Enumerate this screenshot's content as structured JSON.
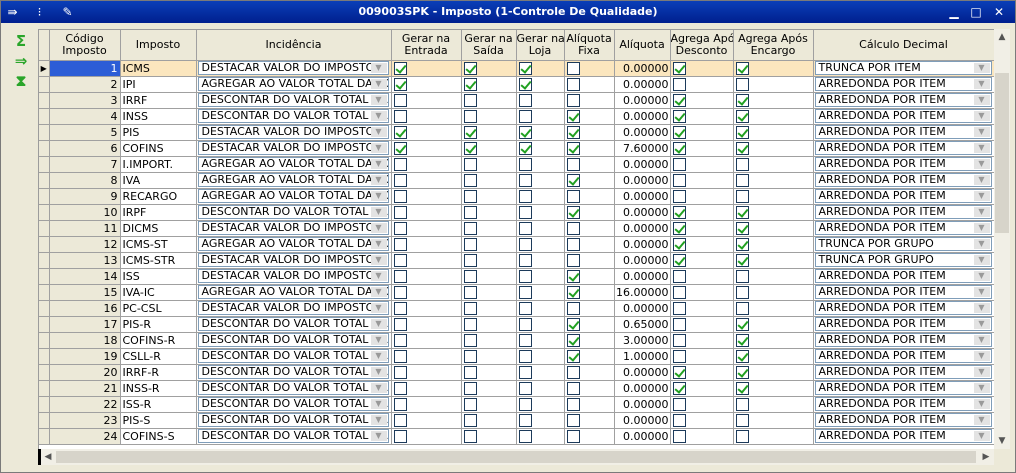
{
  "window": {
    "title": "009003SPK - Imposto (1-Controle De Qualidade)",
    "icons": [
      "menu-arrow-icon",
      "traffic-light-icon",
      "wrench-icon"
    ],
    "controls": {
      "minimize": "▁",
      "maximize": "□",
      "close": "✕"
    }
  },
  "sidebar": [
    {
      "name": "sum-icon",
      "glyph": "Σ"
    },
    {
      "name": "export-icon",
      "glyph": "⇒"
    },
    {
      "name": "filter-icon",
      "glyph": "⧗"
    }
  ],
  "columns": [
    {
      "key": "codigo",
      "label_lines": [
        "Código",
        "Imposto"
      ]
    },
    {
      "key": "imposto",
      "label_lines": [
        "Imposto"
      ]
    },
    {
      "key": "incidencia",
      "label_lines": [
        "Incidência"
      ]
    },
    {
      "key": "gerar_entrada",
      "label_lines": [
        "Gerar na",
        "Entrada"
      ]
    },
    {
      "key": "gerar_saida",
      "label_lines": [
        "Gerar na",
        "Saída"
      ]
    },
    {
      "key": "gerar_loja",
      "label_lines": [
        "Gerar na",
        "Loja"
      ]
    },
    {
      "key": "aliquota_fixa",
      "label_lines": [
        "Alíquota",
        "Fixa"
      ]
    },
    {
      "key": "aliquota",
      "label_lines": [
        "Alíquota"
      ]
    },
    {
      "key": "agrega_desconto",
      "label_lines": [
        "Agrega Após",
        "Desconto"
      ]
    },
    {
      "key": "agrega_encargo",
      "label_lines": [
        "Agrega Após",
        "Encargo"
      ]
    },
    {
      "key": "calculo",
      "label_lines": [
        "Cálculo Decimal"
      ]
    }
  ],
  "rows": [
    {
      "codigo": "1",
      "imposto": "ICMS",
      "incidencia": "DESTACAR VALOR DO IMPOSTO",
      "gerar_entrada": true,
      "gerar_saida": true,
      "gerar_loja": true,
      "aliquota_fixa": false,
      "aliquota": "0.00000",
      "agrega_desconto": true,
      "agrega_encargo": true,
      "calculo": "TRUNCA POR ITEM",
      "selected": true
    },
    {
      "codigo": "2",
      "imposto": "IPI",
      "incidencia": "AGREGAR AO VALOR TOTAL DA NO",
      "gerar_entrada": true,
      "gerar_saida": true,
      "gerar_loja": true,
      "aliquota_fixa": false,
      "aliquota": "0.00000",
      "agrega_desconto": false,
      "agrega_encargo": false,
      "calculo": "ARREDONDA POR ITEM"
    },
    {
      "codigo": "3",
      "imposto": "IRRF",
      "incidencia": "DESCONTAR DO VALOR TOTAL DA",
      "gerar_entrada": false,
      "gerar_saida": false,
      "gerar_loja": false,
      "aliquota_fixa": false,
      "aliquota": "0.00000",
      "agrega_desconto": true,
      "agrega_encargo": true,
      "calculo": "ARREDONDA POR ITEM"
    },
    {
      "codigo": "4",
      "imposto": "INSS",
      "incidencia": "DESCONTAR DO VALOR TOTAL DA",
      "gerar_entrada": false,
      "gerar_saida": false,
      "gerar_loja": false,
      "aliquota_fixa": true,
      "aliquota": "0.00000",
      "agrega_desconto": true,
      "agrega_encargo": true,
      "calculo": "ARREDONDA POR ITEM"
    },
    {
      "codigo": "5",
      "imposto": "PIS",
      "incidencia": "DESTACAR VALOR DO IMPOSTO",
      "gerar_entrada": true,
      "gerar_saida": true,
      "gerar_loja": true,
      "aliquota_fixa": true,
      "aliquota": "0.00000",
      "agrega_desconto": true,
      "agrega_encargo": true,
      "calculo": "ARREDONDA POR ITEM"
    },
    {
      "codigo": "6",
      "imposto": "COFINS",
      "incidencia": "DESTACAR VALOR DO IMPOSTO",
      "gerar_entrada": true,
      "gerar_saida": true,
      "gerar_loja": true,
      "aliquota_fixa": true,
      "aliquota": "7.60000",
      "agrega_desconto": true,
      "agrega_encargo": true,
      "calculo": "ARREDONDA POR ITEM"
    },
    {
      "codigo": "7",
      "imposto": "I.IMPORT.",
      "incidencia": "AGREGAR AO VALOR TOTAL DA NO",
      "gerar_entrada": false,
      "gerar_saida": false,
      "gerar_loja": false,
      "aliquota_fixa": false,
      "aliquota": "0.00000",
      "agrega_desconto": false,
      "agrega_encargo": false,
      "calculo": "ARREDONDA POR ITEM"
    },
    {
      "codigo": "8",
      "imposto": "IVA",
      "incidencia": "AGREGAR AO VALOR TOTAL DA NO",
      "gerar_entrada": false,
      "gerar_saida": false,
      "gerar_loja": false,
      "aliquota_fixa": true,
      "aliquota": "0.00000",
      "agrega_desconto": false,
      "agrega_encargo": false,
      "calculo": "ARREDONDA POR ITEM"
    },
    {
      "codigo": "9",
      "imposto": "RECARGO",
      "incidencia": "AGREGAR AO VALOR TOTAL DA NO",
      "gerar_entrada": false,
      "gerar_saida": false,
      "gerar_loja": false,
      "aliquota_fixa": false,
      "aliquota": "0.00000",
      "agrega_desconto": false,
      "agrega_encargo": false,
      "calculo": "ARREDONDA POR ITEM"
    },
    {
      "codigo": "10",
      "imposto": "IRPF",
      "incidencia": "DESCONTAR DO VALOR TOTAL DA",
      "gerar_entrada": false,
      "gerar_saida": false,
      "gerar_loja": false,
      "aliquota_fixa": true,
      "aliquota": "0.00000",
      "agrega_desconto": true,
      "agrega_encargo": true,
      "calculo": "ARREDONDA POR ITEM"
    },
    {
      "codigo": "11",
      "imposto": "DICMS",
      "incidencia": "DESTACAR VALOR DO IMPOSTO",
      "gerar_entrada": false,
      "gerar_saida": false,
      "gerar_loja": false,
      "aliquota_fixa": false,
      "aliquota": "0.00000",
      "agrega_desconto": true,
      "agrega_encargo": true,
      "calculo": "ARREDONDA POR ITEM"
    },
    {
      "codigo": "12",
      "imposto": "ICMS-ST",
      "incidencia": "AGREGAR AO VALOR TOTAL DA NO",
      "gerar_entrada": false,
      "gerar_saida": false,
      "gerar_loja": false,
      "aliquota_fixa": false,
      "aliquota": "0.00000",
      "agrega_desconto": true,
      "agrega_encargo": true,
      "calculo": "TRUNCA POR GRUPO"
    },
    {
      "codigo": "13",
      "imposto": "ICMS-STR",
      "incidencia": "DESTACAR VALOR DO IMPOSTO",
      "gerar_entrada": false,
      "gerar_saida": false,
      "gerar_loja": false,
      "aliquota_fixa": false,
      "aliquota": "0.00000",
      "agrega_desconto": true,
      "agrega_encargo": true,
      "calculo": "TRUNCA POR GRUPO"
    },
    {
      "codigo": "14",
      "imposto": "ISS",
      "incidencia": "DESTACAR VALOR DO IMPOSTO",
      "gerar_entrada": false,
      "gerar_saida": false,
      "gerar_loja": false,
      "aliquota_fixa": true,
      "aliquota": "0.00000",
      "agrega_desconto": false,
      "agrega_encargo": false,
      "calculo": "ARREDONDA POR ITEM"
    },
    {
      "codigo": "15",
      "imposto": "IVA-IC",
      "incidencia": "AGREGAR AO VALOR TOTAL DA NO",
      "gerar_entrada": false,
      "gerar_saida": false,
      "gerar_loja": false,
      "aliquota_fixa": true,
      "aliquota": "16.00000",
      "agrega_desconto": false,
      "agrega_encargo": false,
      "calculo": "ARREDONDA POR ITEM"
    },
    {
      "codigo": "16",
      "imposto": "PC-CSL",
      "incidencia": "DESTACAR VALOR DO IMPOSTO",
      "gerar_entrada": false,
      "gerar_saida": false,
      "gerar_loja": false,
      "aliquota_fixa": false,
      "aliquota": "0.00000",
      "agrega_desconto": false,
      "agrega_encargo": false,
      "calculo": "ARREDONDA POR ITEM"
    },
    {
      "codigo": "17",
      "imposto": "PIS-R",
      "incidencia": "DESCONTAR DO VALOR TOTAL DA",
      "gerar_entrada": false,
      "gerar_saida": false,
      "gerar_loja": false,
      "aliquota_fixa": true,
      "aliquota": "0.65000",
      "agrega_desconto": false,
      "agrega_encargo": true,
      "calculo": "ARREDONDA POR ITEM"
    },
    {
      "codigo": "18",
      "imposto": "COFINS-R",
      "incidencia": "DESCONTAR DO VALOR TOTAL DA",
      "gerar_entrada": false,
      "gerar_saida": false,
      "gerar_loja": false,
      "aliquota_fixa": true,
      "aliquota": "3.00000",
      "agrega_desconto": false,
      "agrega_encargo": true,
      "calculo": "ARREDONDA POR ITEM"
    },
    {
      "codigo": "19",
      "imposto": "CSLL-R",
      "incidencia": "DESCONTAR DO VALOR TOTAL DA",
      "gerar_entrada": false,
      "gerar_saida": false,
      "gerar_loja": false,
      "aliquota_fixa": true,
      "aliquota": "1.00000",
      "agrega_desconto": false,
      "agrega_encargo": true,
      "calculo": "ARREDONDA POR ITEM"
    },
    {
      "codigo": "20",
      "imposto": "IRRF-R",
      "incidencia": "DESCONTAR DO VALOR TOTAL DA",
      "gerar_entrada": false,
      "gerar_saida": false,
      "gerar_loja": false,
      "aliquota_fixa": false,
      "aliquota": "0.00000",
      "agrega_desconto": true,
      "agrega_encargo": true,
      "calculo": "ARREDONDA POR ITEM"
    },
    {
      "codigo": "21",
      "imposto": "INSS-R",
      "incidencia": "DESCONTAR DO VALOR TOTAL DA",
      "gerar_entrada": false,
      "gerar_saida": false,
      "gerar_loja": false,
      "aliquota_fixa": false,
      "aliquota": "0.00000",
      "agrega_desconto": true,
      "agrega_encargo": true,
      "calculo": "ARREDONDA POR ITEM"
    },
    {
      "codigo": "22",
      "imposto": "ISS-R",
      "incidencia": "DESCONTAR DO VALOR TOTAL DA",
      "gerar_entrada": false,
      "gerar_saida": false,
      "gerar_loja": false,
      "aliquota_fixa": false,
      "aliquota": "0.00000",
      "agrega_desconto": false,
      "agrega_encargo": false,
      "calculo": "ARREDONDA POR ITEM"
    },
    {
      "codigo": "23",
      "imposto": "PIS-S",
      "incidencia": "DESCONTAR DO VALOR TOTAL DA",
      "gerar_entrada": false,
      "gerar_saida": false,
      "gerar_loja": false,
      "aliquota_fixa": false,
      "aliquota": "0.00000",
      "agrega_desconto": false,
      "agrega_encargo": false,
      "calculo": "ARREDONDA POR ITEM"
    },
    {
      "codigo": "24",
      "imposto": "COFINS-S",
      "incidencia": "DESCONTAR DO VALOR TOTAL DA",
      "gerar_entrada": false,
      "gerar_saida": false,
      "gerar_loja": false,
      "aliquota_fixa": false,
      "aliquota": "0.00000",
      "agrega_desconto": false,
      "agrega_encargo": false,
      "calculo": "ARREDONDA POR ITEM"
    }
  ],
  "colors": {
    "title_bar": "#0a3fb8",
    "selected_code": "#2c5dd6",
    "selected_row": "#fbe6be",
    "check": "#21a121"
  }
}
